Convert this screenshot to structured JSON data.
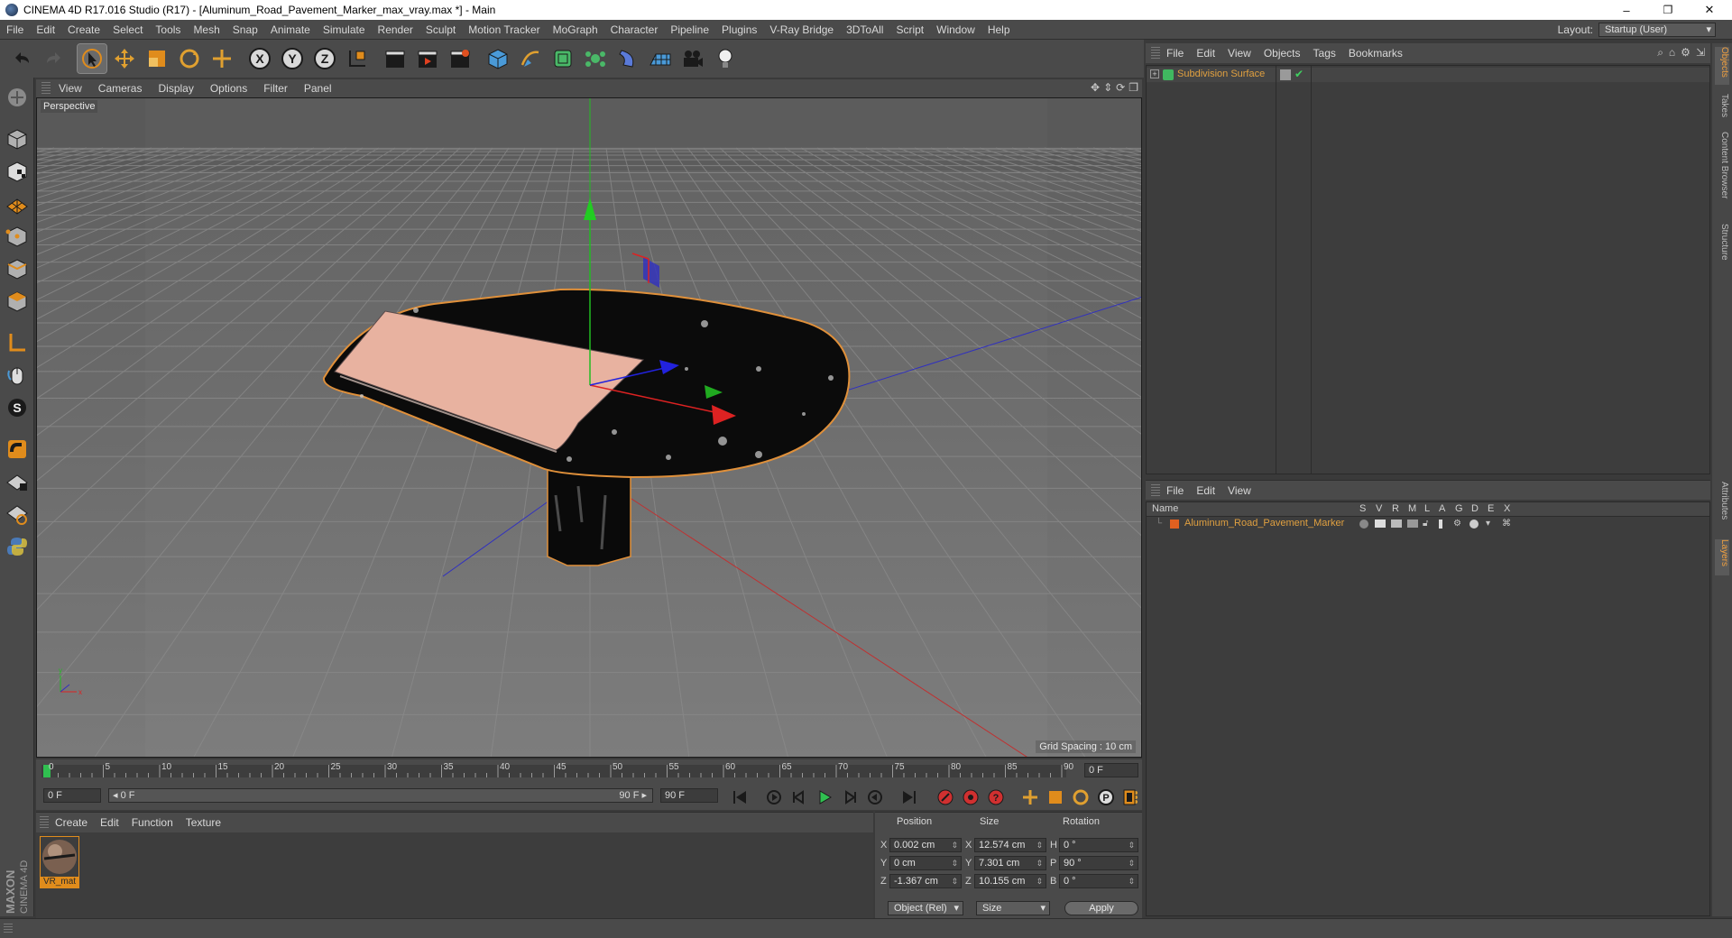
{
  "window": {
    "title": "CINEMA 4D R17.016 Studio (R17) - [Aluminum_Road_Pavement_Marker_max_vray.max *] - Main",
    "minimize": "–",
    "maximize": "❐",
    "close": "✕"
  },
  "menu": [
    "File",
    "Edit",
    "Create",
    "Select",
    "Tools",
    "Mesh",
    "Snap",
    "Animate",
    "Simulate",
    "Render",
    "Sculpt",
    "Motion Tracker",
    "MoGraph",
    "Character",
    "Pipeline",
    "Plugins",
    "V-Ray Bridge",
    "3DToAll",
    "Script",
    "Window",
    "Help"
  ],
  "layout": {
    "label": "Layout:",
    "value": "Startup (User)"
  },
  "viewport": {
    "menu": [
      "View",
      "Cameras",
      "Display",
      "Options",
      "Filter",
      "Panel"
    ],
    "camera_label": "Perspective",
    "grid_spacing": "Grid Spacing : 10 cm"
  },
  "timeline": {
    "ticks": [
      "0",
      "5",
      "10",
      "15",
      "20",
      "25",
      "30",
      "35",
      "40",
      "45",
      "50",
      "55",
      "60",
      "65",
      "70",
      "75",
      "80",
      "85",
      "90"
    ],
    "current_frame_field": "0 F",
    "start_field": "0 F",
    "range_start": "◂ 0 F",
    "range_end": "90 F ▸",
    "end_field": "90 F"
  },
  "material_manager": {
    "menu": [
      "Create",
      "Edit",
      "Function",
      "Texture"
    ],
    "material_name": "VR_mat"
  },
  "coordinates": {
    "headers": {
      "position": "Position",
      "size": "Size",
      "rotation": "Rotation"
    },
    "rows": [
      {
        "axis": "X",
        "pos": "0.002 cm",
        "size_axis": "X",
        "size": "12.574 cm",
        "rot_axis": "H",
        "rot": "0 °"
      },
      {
        "axis": "Y",
        "pos": "0 cm",
        "size_axis": "Y",
        "size": "7.301 cm",
        "rot_axis": "P",
        "rot": "90 °"
      },
      {
        "axis": "Z",
        "pos": "-1.367 cm",
        "size_axis": "Z",
        "size": "10.155 cm",
        "rot_axis": "B",
        "rot": "0 °"
      }
    ],
    "mode_dropdown": "Object (Rel)",
    "size_dropdown": "Size",
    "apply_label": "Apply"
  },
  "object_manager": {
    "menu": [
      "File",
      "Edit",
      "View",
      "Objects",
      "Tags",
      "Bookmarks"
    ],
    "object_name": "Subdivision Surface"
  },
  "layer_manager": {
    "menu": [
      "File",
      "Edit",
      "View"
    ],
    "columns": [
      "Name",
      "S",
      "V",
      "R",
      "M",
      "L",
      "A",
      "G",
      "D",
      "E",
      "X"
    ],
    "layer_name": "Aluminum_Road_Pavement_Marker"
  },
  "side_tabs": [
    "Objects",
    "Takes",
    "Content Browser",
    "Structure",
    "Attributes",
    "Layers"
  ],
  "branding": {
    "maxon": "MAXON",
    "product": "CINEMA 4D"
  },
  "colors": {
    "accent": "#e08c1c",
    "background": "#4a4a4a",
    "panel": "#3d3d3d"
  }
}
